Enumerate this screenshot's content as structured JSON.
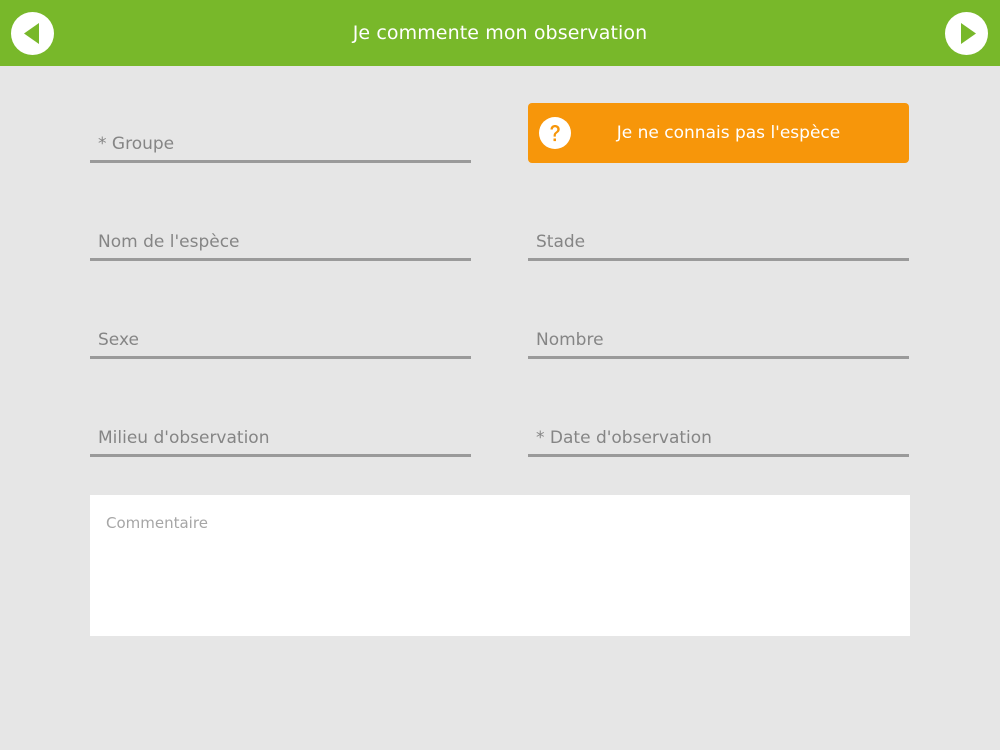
{
  "header": {
    "title": "Je commente mon observation",
    "back_icon": "arrow-left-icon",
    "next_icon": "arrow-right-icon",
    "color": "#78b82a"
  },
  "form": {
    "group_placeholder": "* Groupe",
    "unknown_species_button": "Je ne connais pas l'espèce",
    "unknown_species_icon": "question-circle-icon",
    "species_name_placeholder": "Nom de l'espèce",
    "stage_placeholder": "Stade",
    "sex_placeholder": "Sexe",
    "count_placeholder": "Nombre",
    "habitat_placeholder": "Milieu d'observation",
    "date_placeholder": "* Date d'observation",
    "comment_placeholder": "Commentaire"
  },
  "colors": {
    "accent_orange": "#f7960a",
    "background": "#e6e6e6",
    "underline": "#9a9a9a"
  }
}
